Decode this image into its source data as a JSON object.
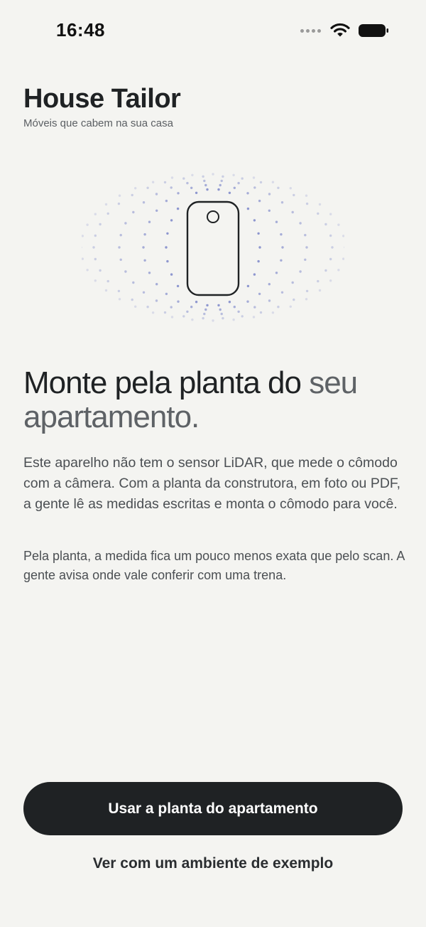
{
  "status_bar": {
    "time": "16:48",
    "signal_icon": "cellular-dots-icon",
    "wifi_icon": "wifi-icon",
    "battery_icon": "battery-icon"
  },
  "header": {
    "title": "House Tailor",
    "subtitle": "Móveis que cabem na sua casa"
  },
  "illustration": {
    "icon": "phone-scan-icon",
    "accent_color": "#7b86c9"
  },
  "headline": {
    "part1": "Monte pela planta do ",
    "part2": "seu apartamento."
  },
  "body": {
    "paragraph1": "Este aparelho não tem o sensor LiDAR, que mede o cômodo com a câmera. Com a planta da construtora, em foto ou PDF, a gente lê as medidas escritas e monta o cômodo para você.",
    "paragraph2": "Pela planta, a medida fica um pouco menos exata que pelo scan. A gente avisa onde vale conferir com uma trena."
  },
  "actions": {
    "primary_label": "Usar a planta do apartamento",
    "secondary_label": "Ver com um ambiente de exemplo"
  },
  "colors": {
    "background": "#f4f4f1",
    "primary": "#1f2224",
    "muted_text": "#5e6266"
  }
}
